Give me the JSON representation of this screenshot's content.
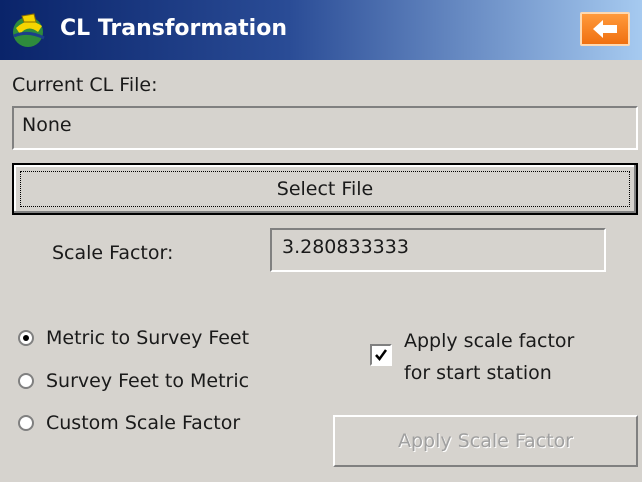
{
  "title": "CL Transformation",
  "current_file_label": "Current CL File:",
  "current_file_value": "None",
  "select_file_label": "Select File",
  "scale_factor_label": "Scale Factor:",
  "scale_factor_value": "3.280833333",
  "options": [
    {
      "label": "Metric to Survey Feet",
      "selected": true
    },
    {
      "label": "Survey Feet to Metric",
      "selected": false
    },
    {
      "label": "Custom Scale Factor",
      "selected": false
    }
  ],
  "apply_start_station": {
    "line1": "Apply scale factor",
    "line2": "for start station",
    "checked": true
  },
  "apply_button_label": "Apply Scale Factor",
  "colors": {
    "accent": "#f07010",
    "titlebar": "#0a246a"
  },
  "icons": {
    "app": "app-logo-icon",
    "back": "back-arrow-icon"
  }
}
